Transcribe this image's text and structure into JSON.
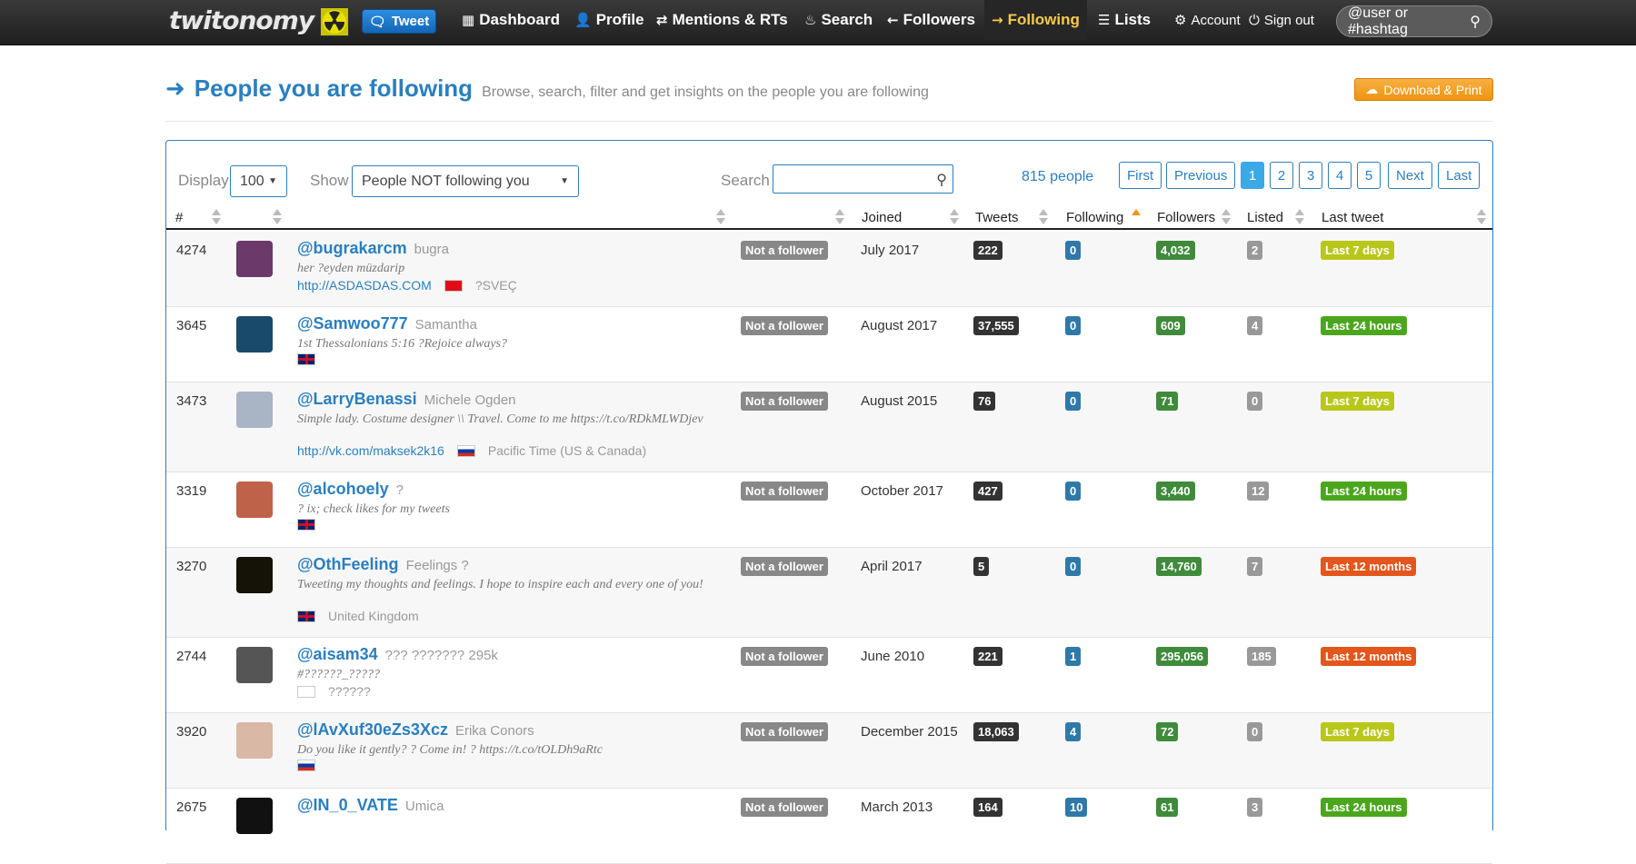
{
  "nav": {
    "logo": "twitonomy",
    "tweet_label": "Tweet",
    "items": [
      {
        "label": "Dashboard",
        "icon": "grid"
      },
      {
        "label": "Profile",
        "icon": "user"
      },
      {
        "label": "Mentions & RTs",
        "icon": "retweet"
      },
      {
        "label": "Search",
        "icon": "fire"
      },
      {
        "label": "Followers",
        "icon": "arrow-left"
      },
      {
        "label": "Following",
        "icon": "arrow-right"
      },
      {
        "label": "Lists",
        "icon": "list"
      }
    ],
    "account_label": "Account",
    "signout_label": "Sign out",
    "search_placeholder": "@user or #hashtag"
  },
  "header": {
    "title": "People you are following",
    "subtitle": "Browse, search, filter and get insights on the people you are following",
    "download_label": "Download & Print"
  },
  "controls": {
    "display_label": "Display",
    "display_value": "100",
    "show_label": "Show",
    "show_value": "People NOT following you",
    "search_label": "Search",
    "search_value": "",
    "count": "815 people",
    "pagination": [
      "First",
      "Previous",
      "1",
      "2",
      "3",
      "4",
      "5",
      "Next",
      "Last"
    ],
    "active_page": "1"
  },
  "columns": [
    "#",
    "",
    "",
    "",
    "Joined",
    "Tweets",
    "Following",
    "Followers",
    "Listed",
    "Last tweet"
  ],
  "rows": [
    {
      "num": "4274",
      "handle": "@bugrakarcm",
      "name": "bugra",
      "bio": "her ?eyden müzdarip",
      "url": "http://ASDASDAS.COM",
      "location": "?SVEÇ",
      "flag": "tr",
      "status": "Not a follower",
      "joined": "July 2017",
      "tweets": "222",
      "following": "0",
      "followers": "4,032",
      "listed": "2",
      "last": "Last 7 days",
      "last_color": "#b9c71a",
      "avatar_color": "#6b3a6b"
    },
    {
      "num": "3645",
      "handle": "@Samwoo777",
      "name": "Samantha",
      "bio": "1st Thessalonians 5:16 ?Rejoice always?",
      "url": "",
      "location": "",
      "flag": "uk",
      "status": "Not a follower",
      "joined": "August 2017",
      "tweets": "37,555",
      "following": "0",
      "followers": "609",
      "listed": "4",
      "last": "Last 24 hours",
      "last_color": "#4ca61d",
      "avatar_color": "#1a4a6b"
    },
    {
      "num": "3473",
      "handle": "@LarryBenassi",
      "name": "Michele Ogden",
      "bio": "Simple lady. Costume designer \\\\ Travel. Come to me https://t.co/RDkMLWDjev",
      "url": "http://vk.com/maksek2k16",
      "location": "Pacific Time (US & Canada)",
      "flag": "ru",
      "status": "Not a follower",
      "joined": "August 2015",
      "tweets": "76",
      "following": "0",
      "followers": "71",
      "listed": "0",
      "last": "Last 7 days",
      "last_color": "#b9c71a",
      "avatar_color": "#a9b4c4"
    },
    {
      "num": "3319",
      "handle": "@alcohoely",
      "name": "?",
      "bio": "? ix; check likes for my tweets",
      "url": "",
      "location": "",
      "flag": "uk",
      "status": "Not a follower",
      "joined": "October 2017",
      "tweets": "427",
      "following": "0",
      "followers": "3,440",
      "listed": "12",
      "last": "Last 24 hours",
      "last_color": "#4ca61d",
      "avatar_color": "#c0624a"
    },
    {
      "num": "3270",
      "handle": "@OthFeeling",
      "name": "Feelings ?",
      "bio": "Tweeting my thoughts and feelings. I hope to inspire each and every one of you!",
      "url": "",
      "location": "United Kingdom",
      "flag": "uk",
      "status": "Not a follower",
      "joined": "April 2017",
      "tweets": "5",
      "following": "0",
      "followers": "14,760",
      "listed": "7",
      "last": "Last 12 months",
      "last_color": "#e4561b",
      "avatar_color": "#151208"
    },
    {
      "num": "2744",
      "handle": "@aisam34",
      "name": "??? ??????? 295k",
      "bio": "#??????_?????",
      "url": "",
      "location": "??????",
      "flag": "ar",
      "status": "Not a follower",
      "joined": "June 2010",
      "tweets": "221",
      "following": "1",
      "followers": "295,056",
      "listed": "185",
      "last": "Last 12 months",
      "last_color": "#e4561b",
      "avatar_color": "#555"
    },
    {
      "num": "3920",
      "handle": "@lAvXuf30eZs3Xcz",
      "name": "Erika Conors",
      "bio": "Do you like it gently? ? Come in! ? https://t.co/tOLDh9aRtc",
      "url": "",
      "location": "",
      "flag": "ru",
      "status": "Not a follower",
      "joined": "December 2015",
      "tweets": "18,063",
      "following": "4",
      "followers": "72",
      "listed": "0",
      "last": "Last 7 days",
      "last_color": "#b9c71a",
      "avatar_color": "#d9b8a6"
    },
    {
      "num": "2675",
      "handle": "@IN_0_VATE",
      "name": "Umica",
      "bio": "",
      "url": "",
      "location": "",
      "flag": "",
      "status": "Not a follower",
      "joined": "March 2013",
      "tweets": "164",
      "following": "10",
      "followers": "61",
      "listed": "3",
      "last": "Last 24 hours",
      "last_color": "#4ca61d",
      "avatar_color": "#111"
    }
  ]
}
